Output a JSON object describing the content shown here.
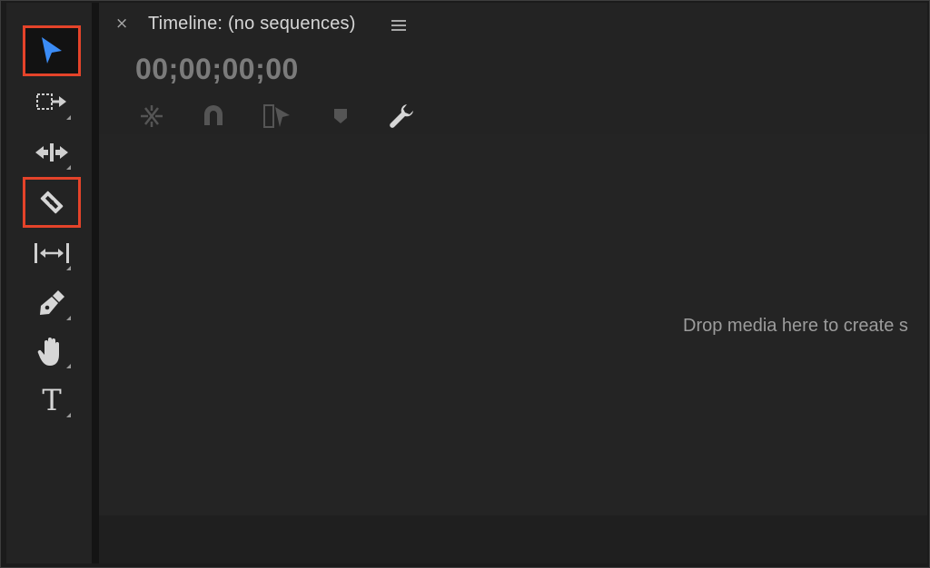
{
  "tools_panel": {
    "tools": [
      {
        "id": "selection",
        "icon": "selection-arrow-icon",
        "selected": true,
        "highlight_color": "#e4432a",
        "icon_color": "#3b8cf6"
      },
      {
        "id": "track-select-forward",
        "icon": "track-select-forward-icon",
        "selected": false
      },
      {
        "id": "ripple-edit",
        "icon": "ripple-edit-icon",
        "selected": false
      },
      {
        "id": "razor",
        "icon": "razor-icon",
        "selected": false,
        "highlighted": true,
        "highlight_color": "#e4432a"
      },
      {
        "id": "slip",
        "icon": "slip-icon",
        "selected": false
      },
      {
        "id": "pen",
        "icon": "pen-icon",
        "selected": false
      },
      {
        "id": "hand",
        "icon": "hand-icon",
        "selected": false
      },
      {
        "id": "type",
        "icon": "type-icon",
        "selected": false,
        "glyph": "T"
      }
    ]
  },
  "timeline": {
    "close_glyph": "×",
    "title": "Timeline: (no sequences)",
    "menu_icon": "hamburger-menu-icon",
    "timecode": "00;00;00;00",
    "controls": [
      {
        "id": "insert-overwrite-nest",
        "icon": "nest-sequence-icon"
      },
      {
        "id": "snap",
        "icon": "magnet-snap-icon"
      },
      {
        "id": "linked-selection",
        "icon": "linked-selection-icon"
      },
      {
        "id": "add-marker",
        "icon": "marker-icon"
      },
      {
        "id": "timeline-settings",
        "icon": "wrench-icon"
      }
    ],
    "drop_message": "Drop media here to create s"
  }
}
